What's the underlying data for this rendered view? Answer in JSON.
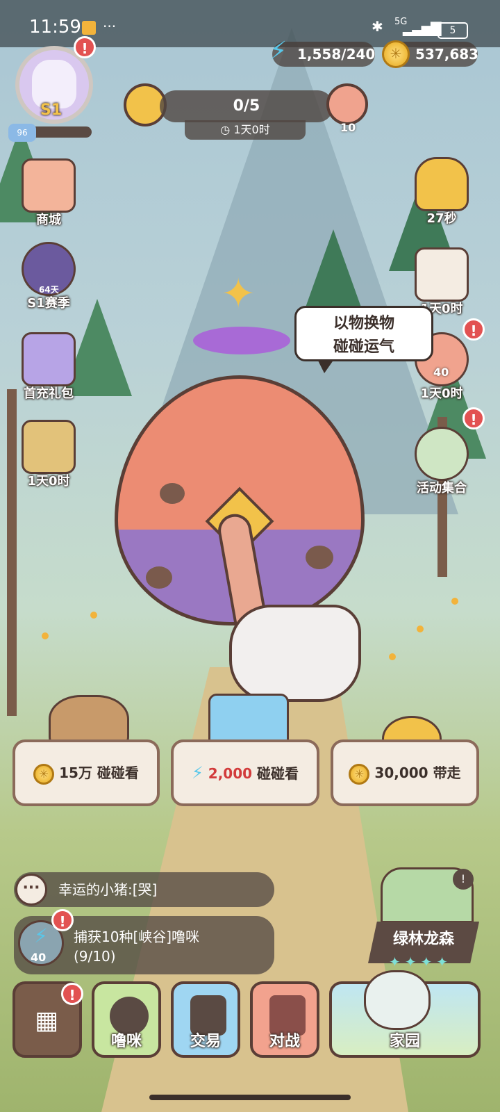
{
  "status_bar": {
    "time": "11:59",
    "more": "···",
    "network": "5G",
    "battery": "5"
  },
  "currencies": {
    "energy": "1,558/240",
    "coins": "537,683"
  },
  "player": {
    "season_badge": "S1",
    "level": "96"
  },
  "top_task": {
    "progress": "0/5",
    "timer": "1天0时",
    "reward_count": "10"
  },
  "left_menu": [
    {
      "label": "商城"
    },
    {
      "label": "S1赛季",
      "sub": "64天"
    },
    {
      "label": "首充礼包"
    },
    {
      "label": "1天0时"
    }
  ],
  "right_menu": [
    {
      "label": "27秒"
    },
    {
      "label": "1天0时"
    },
    {
      "label": "1天0时",
      "count": "40"
    },
    {
      "label": "活动集合"
    }
  ],
  "speech_bubble": {
    "line1": "以物换物",
    "line2": "碰碰运气"
  },
  "actions": [
    {
      "amount": "15万",
      "text": "碰碰看",
      "icon": "coin-icon"
    },
    {
      "amount": "2,000",
      "text": "碰碰看",
      "icon": "energy-bolt-icon"
    },
    {
      "amount": "30,000",
      "text": "带走",
      "icon": "coin-icon"
    }
  ],
  "chat": {
    "message": "幸运的小猪:[哭]"
  },
  "quest": {
    "title": "捕获10种[峡谷]噜咪",
    "progress": "(9/10)",
    "reward": "40"
  },
  "region": {
    "name": "绿林龙森",
    "stars": "✦✦✦✦"
  },
  "bottom_nav": [
    {
      "label": ""
    },
    {
      "label": "噜咪"
    },
    {
      "label": "交易"
    },
    {
      "label": "对战"
    },
    {
      "label": "家园"
    }
  ],
  "colors": {
    "alert": "#e25252",
    "energy": "#58c7ea",
    "coin": "#e8a91a",
    "price_red": "#d23b3b"
  }
}
